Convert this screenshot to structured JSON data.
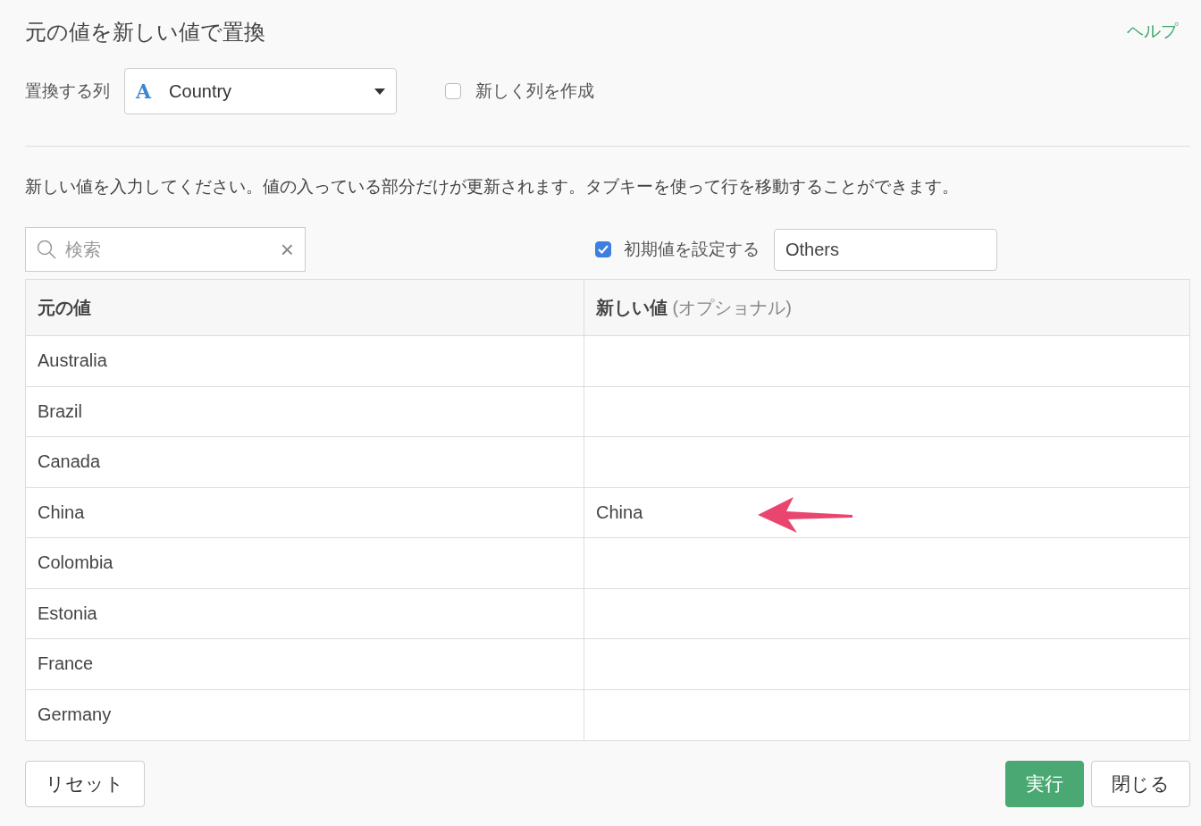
{
  "dialog": {
    "title": "元の値を新しい値で置換",
    "help_link": "ヘルプ"
  },
  "column_select": {
    "label": "置換する列",
    "type_icon": "A",
    "value": "Country"
  },
  "new_column": {
    "label": "新しく列を作成",
    "checked": false
  },
  "instruction": "新しい値を入力してください。値の入っている部分だけが更新されます。タブキーを使って行を移動することができます。",
  "search": {
    "placeholder": "検索",
    "clear": "×"
  },
  "default_value": {
    "label": "初期値を設定する",
    "checked": true,
    "value": "Others"
  },
  "table": {
    "columns": [
      "元の値",
      "**新しい値** (オプショナル)"
    ],
    "rows": [
      {
        "original": "Australia",
        "new": ""
      },
      {
        "original": "Brazil",
        "new": ""
      },
      {
        "original": "Canada",
        "new": ""
      },
      {
        "original": "China",
        "new": "China",
        "highlighted": true
      },
      {
        "original": "Colombia",
        "new": ""
      },
      {
        "original": "Estonia",
        "new": ""
      },
      {
        "original": "France",
        "new": ""
      },
      {
        "original": "Germany",
        "new": ""
      }
    ]
  },
  "buttons": {
    "reset": "リセット",
    "run": "実行",
    "close": "閉じる"
  }
}
